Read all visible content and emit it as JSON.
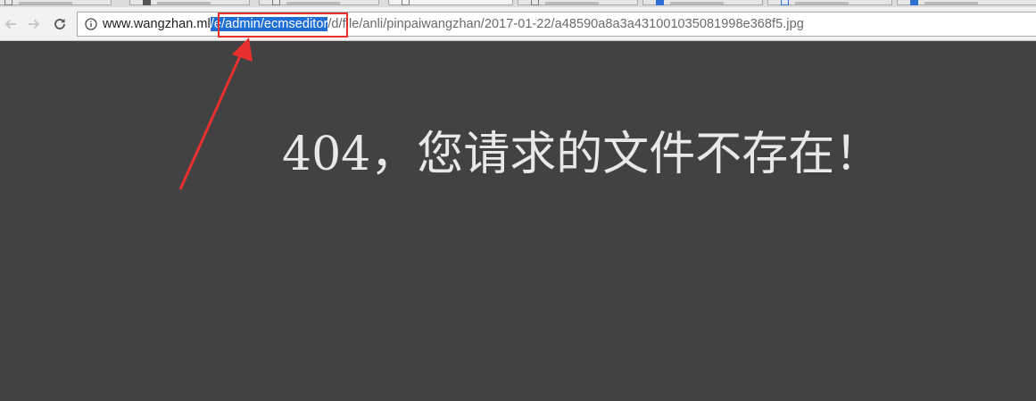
{
  "browser": {
    "address_bar": {
      "url_host": "www.wangzhan.ml",
      "url_selected": "/e/admin/ecmseditor",
      "url_rest": "/d/file/anli/pinpaiwangzhan/2017-01-22/a48590a8a3a431001035081998e368f5.jpg"
    },
    "nav_icons": [
      "back-arrow-icon",
      "forward-arrow-icon",
      "reload-icon",
      "info-icon"
    ]
  },
  "page": {
    "message": "404，您请求的文件不存在！"
  },
  "annotation": {
    "color": "#e8302f"
  },
  "colors": {
    "page_background": "#424242",
    "selection": "#1e6ed3",
    "message_text": "#e8e8e8"
  }
}
